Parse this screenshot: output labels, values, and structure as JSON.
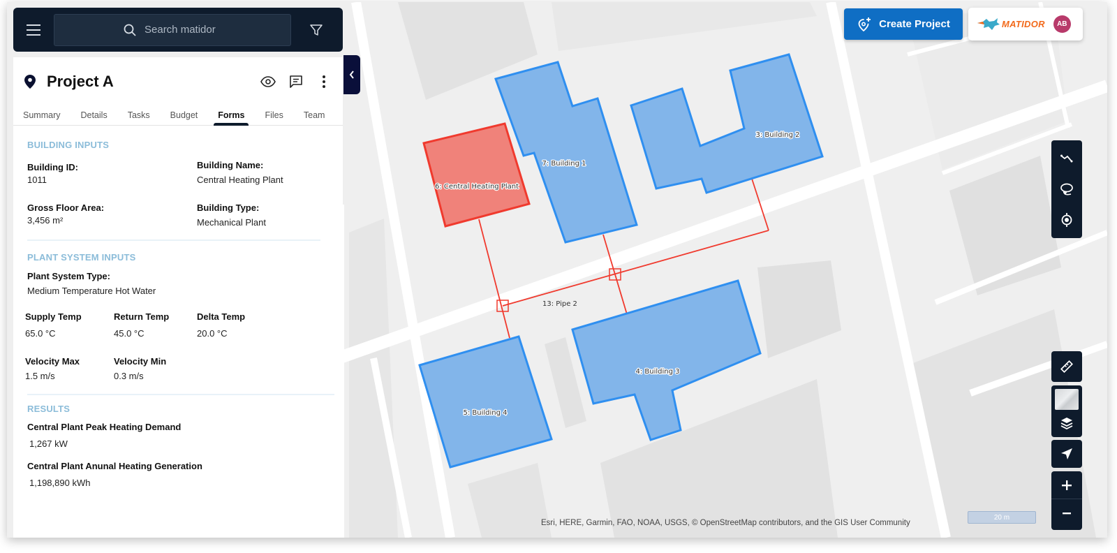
{
  "search": {
    "placeholder": "Search matidor"
  },
  "project": {
    "title": "Project A"
  },
  "tabs": [
    {
      "label": "Summary"
    },
    {
      "label": "Details"
    },
    {
      "label": "Tasks"
    },
    {
      "label": "Budget"
    },
    {
      "label": "Forms",
      "active": true
    },
    {
      "label": "Files"
    },
    {
      "label": "Team"
    }
  ],
  "form": {
    "building_inputs": {
      "title": "BUILDING INPUTS",
      "building_id": {
        "label": "Building ID:",
        "value": "1011"
      },
      "building_name": {
        "label": "Building Name:",
        "value": "Central Heating Plant"
      },
      "gross_floor_area": {
        "label": "Gross Floor Area:",
        "value": "3,456 m²"
      },
      "building_type": {
        "label": "Building Type:",
        "value": "Mechanical Plant"
      }
    },
    "plant_system_inputs": {
      "title": "PLANT SYSTEM INPUTS",
      "plant_system_type": {
        "label": "Plant System Type:",
        "value": "Medium Temperature Hot Water"
      },
      "supply_temp": {
        "label": "Supply Temp",
        "value": "65.0 °C"
      },
      "return_temp": {
        "label": "Return Temp",
        "value": "45.0 °C"
      },
      "delta_temp": {
        "label": "Delta Temp",
        "value": "20.0 °C"
      },
      "velocity_max": {
        "label": "Velocity Max",
        "value": "1.5 m/s"
      },
      "velocity_min": {
        "label": "Velocity Min",
        "value": "0.3 m/s"
      }
    },
    "results": {
      "title": "RESULTS",
      "peak_demand": {
        "label": "Central Plant Peak Heating Demand",
        "value": "1,267 kW"
      },
      "annual_generation": {
        "label": "Central Plant Anunal Heating Generation",
        "value": "1,198,890 kWh"
      }
    }
  },
  "toolbar": {
    "create_project_label": "Create Project",
    "brand_name": "MATIDOR",
    "avatar_initials": "AB"
  },
  "map": {
    "features": [
      {
        "id": "6",
        "label": "6: Central Heating Plant",
        "type": "plant",
        "color": "#f0827a",
        "stroke": "#f03a2e"
      },
      {
        "id": "7",
        "label": "7: Building 1",
        "type": "building",
        "color": "#82b5ea",
        "stroke": "#2f8ff0"
      },
      {
        "id": "3",
        "label": "3: Building 2",
        "type": "building",
        "color": "#82b5ea",
        "stroke": "#2f8ff0"
      },
      {
        "id": "4",
        "label": "4: Building 3",
        "type": "building",
        "color": "#82b5ea",
        "stroke": "#2f8ff0"
      },
      {
        "id": "5",
        "label": "5: Building 4",
        "type": "building",
        "color": "#82b5ea",
        "stroke": "#2f8ff0"
      }
    ],
    "pipe_label": "13: Pipe 2",
    "pipe_color": "#f03a2e",
    "attribution": "Esri, HERE, Garmin, FAO, NOAA, USGS, © OpenStreetMap contributors, and the GIS User Community",
    "scale": "20 m"
  }
}
